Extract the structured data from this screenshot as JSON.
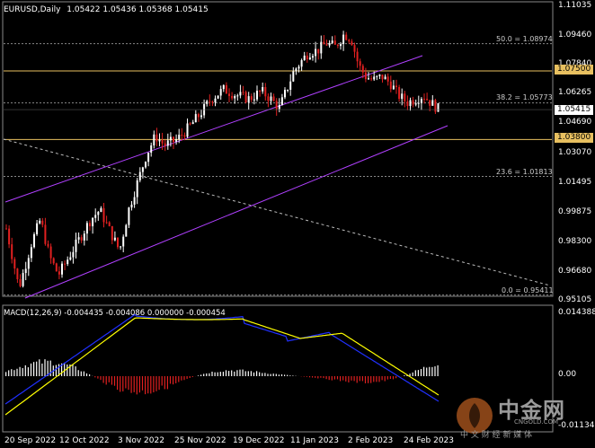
{
  "header": {
    "symbol": "EURUSD,Daily",
    "ohlc": "1.05422 1.05436 1.05368 1.05415"
  },
  "price_axis": {
    "ticks": [
      "1.11035",
      "1.09460",
      "1.07840",
      "1.06265",
      "1.04690",
      "1.03070",
      "1.01495",
      "0.99875",
      "0.98300",
      "0.96680",
      "0.95105"
    ],
    "current_price": "1.05415",
    "level_1": "1.07500",
    "level_2": "1.03800"
  },
  "fibonacci": {
    "levels": [
      "50.0 = 1.08974",
      "38.2 = 1.05773",
      "23.6 = 1.01813",
      "0.0 = 0.95411"
    ]
  },
  "macd": {
    "label": "MACD(12,26,9) -0.004435 -0.004086 0.000000 -0.000454",
    "ticks": [
      "0.014388",
      "0.00",
      "-0.011349"
    ]
  },
  "time_axis": {
    "labels": [
      "20 Sep 2022",
      "12 Oct 2022",
      "3 Nov 2022",
      "25 Nov 2022",
      "19 Dec 2022",
      "11 Jan 2023",
      "2 Feb 2023",
      "24 Feb 2023"
    ]
  },
  "watermark": {
    "brand": "中金网",
    "url": "CNGOLD.COM",
    "slogan": "中 文 财 经 新 媒 体"
  },
  "colors": {
    "bull": "#ffffff",
    "bear": "#e02020",
    "channel": "#b040ff",
    "level": "#e8c060",
    "signal": "#ffff00",
    "macd_line": "#2030ff"
  }
}
